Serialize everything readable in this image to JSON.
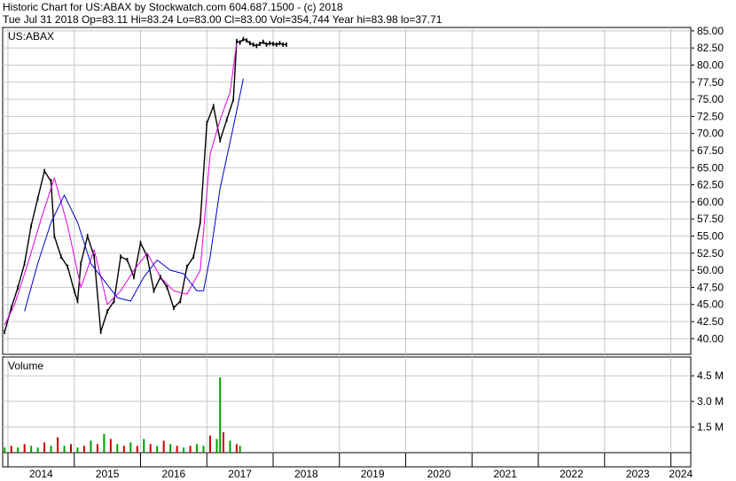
{
  "header": {
    "line1": "Historic Chart for US:ABAX by Stockwatch.com 604.687.1500 - (c) 2018",
    "line2": "Tue Jul 31 2018   Op=83.11   Hi=83.24   Lo=83.00   Cl=83.00   Vol=354,744   Year hi=83.98   lo=37.71"
  },
  "colors": {
    "price": "#000000",
    "ma_short": "#e000e0",
    "ma_long": "#0000cc",
    "vol_up": "#00a000",
    "vol_down": "#d00000",
    "grid": "#c8c8c8"
  },
  "chart_data": [
    {
      "type": "line",
      "panel": "price",
      "symbol": "US:ABAX",
      "ylim": [
        37.71,
        85.5
      ],
      "yticks": [
        "85.00",
        "82.50",
        "80.00",
        "77.50",
        "75.00",
        "72.50",
        "70.00",
        "67.50",
        "65.00",
        "62.50",
        "60.00",
        "57.50",
        "55.00",
        "52.50",
        "50.00",
        "47.50",
        "45.00",
        "42.50",
        "40.00"
      ],
      "x_labels": [
        "2014",
        "2015",
        "2016",
        "2017",
        "2018",
        "2019",
        "2020",
        "2021",
        "2022",
        "2023",
        "2024"
      ],
      "x_range": [
        2013.92,
        2024.3
      ],
      "grid": true,
      "series": [
        {
          "role": "close",
          "x": [
            2013.95,
            2014.05,
            2014.15,
            2014.25,
            2014.35,
            2014.45,
            2014.55,
            2014.65,
            2014.7,
            2014.8,
            2014.9,
            2015.0,
            2015.05,
            2015.1,
            2015.2,
            2015.3,
            2015.4,
            2015.5,
            2015.6,
            2015.7,
            2015.8,
            2015.9,
            2016.0,
            2016.1,
            2016.2,
            2016.3,
            2016.4,
            2016.5,
            2016.6,
            2016.7,
            2016.8,
            2016.9,
            2017.0,
            2017.1,
            2017.2,
            2017.3,
            2017.4,
            2017.45,
            2017.5,
            2017.55,
            2017.6,
            2017.65,
            2017.7,
            2017.75,
            2017.8,
            2017.85,
            2017.9,
            2017.95,
            2018.0,
            2018.05,
            2018.1,
            2018.15,
            2018.2
          ],
          "y": [
            41.0,
            44.5,
            47.5,
            51.0,
            56.5,
            60.5,
            64.5,
            63.0,
            55.0,
            52.0,
            50.5,
            47.0,
            45.5,
            51.0,
            55.0,
            52.0,
            41.0,
            44.0,
            45.5,
            52.0,
            51.5,
            49.0,
            54.0,
            52.0,
            47.0,
            49.0,
            47.5,
            44.5,
            45.5,
            50.5,
            52.0,
            57.0,
            71.5,
            74.0,
            69.0,
            72.0,
            75.0,
            83.5,
            83.3,
            83.8,
            83.6,
            83.2,
            83.0,
            82.8,
            83.1,
            83.4,
            83.0,
            83.2,
            83.1,
            83.0,
            83.2,
            83.0,
            83.0
          ]
        },
        {
          "role": "moving-average-short",
          "x": [
            2013.95,
            2014.1,
            2014.3,
            2014.5,
            2014.7,
            2014.9,
            2015.1,
            2015.3,
            2015.5,
            2015.7,
            2015.9,
            2016.1,
            2016.3,
            2016.5,
            2016.7,
            2016.9,
            2017.05,
            2017.2,
            2017.35,
            2017.45
          ],
          "y": [
            42.0,
            45.0,
            51.0,
            57.5,
            63.5,
            56.5,
            47.5,
            53.0,
            45.0,
            47.0,
            50.0,
            52.5,
            49.0,
            47.0,
            46.5,
            50.0,
            67.0,
            72.0,
            76.0,
            83.2
          ]
        },
        {
          "role": "moving-average-long",
          "x": [
            2014.25,
            2014.45,
            2014.65,
            2014.85,
            2015.05,
            2015.25,
            2015.45,
            2015.65,
            2015.85,
            2016.05,
            2016.25,
            2016.45,
            2016.65,
            2016.85,
            2016.95,
            2017.05,
            2017.2,
            2017.4,
            2017.55
          ],
          "y": [
            44.0,
            51.0,
            57.0,
            61.0,
            57.0,
            51.0,
            48.5,
            46.0,
            45.5,
            49.0,
            51.5,
            50.0,
            49.5,
            47.0,
            47.0,
            52.0,
            62.0,
            71.0,
            78.0
          ]
        }
      ]
    },
    {
      "type": "bar",
      "panel": "volume",
      "title": "Volume",
      "ylim": [
        0,
        5.6
      ],
      "yticks": [
        "4.5 M",
        "3.0 M",
        "1.5 M"
      ],
      "ytick_values": [
        4.5,
        3.0,
        1.5
      ],
      "x": [
        2013.95,
        2014.05,
        2014.15,
        2014.25,
        2014.35,
        2014.45,
        2014.55,
        2014.65,
        2014.75,
        2014.85,
        2014.95,
        2015.05,
        2015.15,
        2015.25,
        2015.35,
        2015.45,
        2015.55,
        2015.65,
        2015.75,
        2015.85,
        2015.95,
        2016.05,
        2016.15,
        2016.25,
        2016.35,
        2016.45,
        2016.55,
        2016.65,
        2016.75,
        2016.85,
        2016.95,
        2017.05,
        2017.15,
        2017.2,
        2017.25,
        2017.35,
        2017.45,
        2017.5
      ],
      "values": [
        0.3,
        0.4,
        0.3,
        0.5,
        0.4,
        0.3,
        0.6,
        0.4,
        0.9,
        0.4,
        0.5,
        0.3,
        0.4,
        0.7,
        0.5,
        1.1,
        0.8,
        0.5,
        0.4,
        0.6,
        0.4,
        0.8,
        0.5,
        0.4,
        0.7,
        0.5,
        0.4,
        0.3,
        0.4,
        0.5,
        0.4,
        1.0,
        0.8,
        4.4,
        1.2,
        0.7,
        0.5,
        0.4
      ],
      "up": [
        true,
        false,
        true,
        false,
        true,
        true,
        false,
        true,
        false,
        true,
        false,
        true,
        false,
        true,
        false,
        true,
        false,
        true,
        false,
        true,
        false,
        true,
        false,
        true,
        false,
        true,
        false,
        true,
        false,
        true,
        true,
        false,
        true,
        true,
        false,
        true,
        false,
        true
      ]
    }
  ]
}
